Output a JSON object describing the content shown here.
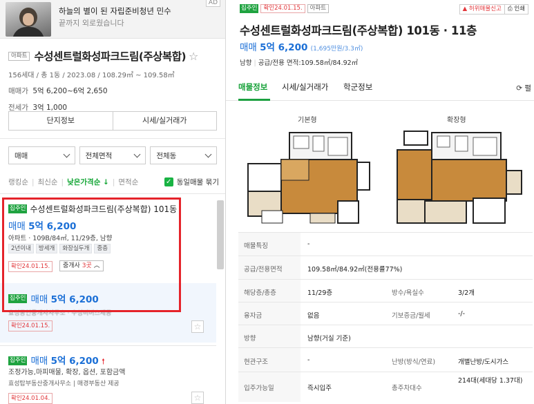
{
  "ad": {
    "line1": "하늘의 별이 된 자립준비청년 민수",
    "line2": "끝까지 외로웠습니다",
    "badge": "AD"
  },
  "complex": {
    "type_tag": "아파트",
    "name": "수성센트럴화성파크드림(주상복합)",
    "meta": "156세대 / 총 1동 / 2023.08 / 108.29㎡ ~ 109.58㎡",
    "sale_label": "매매가",
    "sale_value": "5억 6,200~6억 2,650",
    "jeonse_label": "전세가",
    "jeonse_value": "3억 1,000",
    "btn_info": "단지정보",
    "btn_price": "시세/실거래가"
  },
  "filters": {
    "trade": "매매",
    "area": "전체면적",
    "dong": "전체동"
  },
  "sorts": {
    "s1": "랭킹순",
    "s2": "최신순",
    "s3": "낮은가격순 ↓",
    "s4": "면적순",
    "same_listing": "동일매물 묶기"
  },
  "listings": [
    {
      "badge": "집주인",
      "title": "수성센트럴화성파크드림(주상복합) 101동",
      "trade": "매매",
      "price": "5억 6,200",
      "desc": "아파트 · 109B/84㎡, 11/29층, 남향",
      "tags": [
        "2년이내",
        "방세개",
        "화장실두개",
        "중층"
      ],
      "confirm": "확인24.01.15.",
      "agents_prefix": "중개사",
      "agents_count": "3곳"
    },
    {
      "badge": "집주인",
      "trade": "매매",
      "price": "5억 6,200",
      "blurred": "효성공인중개사사무소 · 수성비버스제공",
      "confirm": "확인24.01.15."
    },
    {
      "badge": "집주인",
      "trade": "매매",
      "price": "5억 6,200",
      "desc": "조정가능,마피매물, 확장, 옵션, 포함금액",
      "sub": "효성탑부동산중개사무소 | 매경부동산 제공",
      "confirm": "확인24.01.04."
    }
  ],
  "detail": {
    "badge": "집주인",
    "confirm": "확인24.01.15.",
    "type_tag": "아파트",
    "report": "허위매물신고",
    "print": "인쇄",
    "title": "수성센트럴화성파크드림(주상복합) 101동 · 11층",
    "trade": "매매",
    "price": "5억 6,200",
    "unit_price": "(1,695만원/3.3㎡)",
    "direction": "남향",
    "area_info": "공급/전용 면적:109.58㎡/84.92㎡",
    "tabs": [
      "매물정보",
      "시세/실거래가",
      "학군정보"
    ],
    "refresh": "⟳ 펼",
    "plan_basic": "기본형",
    "plan_ext": "확장형",
    "rows": [
      {
        "k": "매물특징",
        "v": "-"
      },
      {
        "k": "공급/전용면적",
        "v": "109.58㎡/84.92㎡(전용률77%)"
      },
      {
        "k": "해당층/총층",
        "v": "11/29층",
        "k2": "방수/욕실수",
        "v2": "3/2개"
      },
      {
        "k": "융자금",
        "v": "없음",
        "k2": "기보증금/월세",
        "v2": "-/-"
      },
      {
        "k": "방향",
        "v": "남향(거실 기준)"
      },
      {
        "k": "현관구조",
        "v": "-",
        "k2": "난방(방식/연료)",
        "v2": "개별난방/도시가스"
      },
      {
        "k": "입주가능일",
        "v": "즉시입주",
        "k2": "총주차대수",
        "v2": "214대(세대당 1.37대)"
      }
    ]
  },
  "colors": {
    "green": "#1fa340",
    "blue": "#1b6fd6",
    "red": "#e5232a"
  }
}
